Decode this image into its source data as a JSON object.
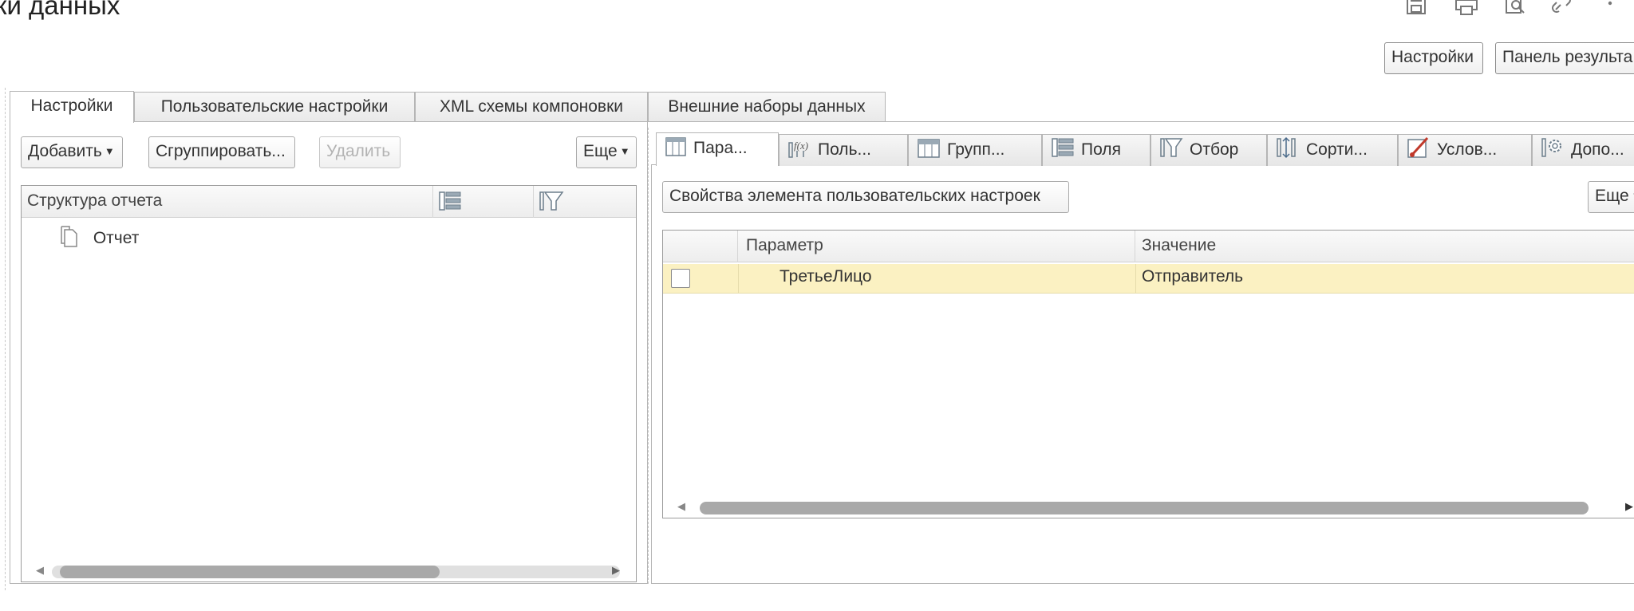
{
  "window": {
    "title": "ки данных",
    "icons": [
      "save-icon",
      "print-icon",
      "preview-icon",
      "link-icon",
      "more-vertical-icon"
    ]
  },
  "header_buttons": {
    "settings": "Настройки",
    "results_panel": "Панель результа"
  },
  "main_tabs": [
    {
      "label": "Настройки",
      "active": true
    },
    {
      "label": "Пользовательские настройки",
      "active": false
    },
    {
      "label": "XML схемы компоновки",
      "active": false
    },
    {
      "label": "Внешние наборы данных",
      "active": false
    }
  ],
  "left_panel": {
    "toolbar": {
      "add": "Добавить",
      "group": "Сгруппировать...",
      "delete": "Удалить",
      "more": "Еще"
    },
    "structure": {
      "header": "Структура отчета",
      "header_icons": [
        "fields-icon",
        "filter-icon"
      ],
      "items": [
        {
          "label": "Отчет",
          "icon": "document-icon"
        }
      ]
    }
  },
  "right_panel": {
    "tabs": [
      {
        "label": "Пара...",
        "icon": "parameters-icon",
        "active": true
      },
      {
        "label": "Поль...",
        "icon": "custom-fields-icon",
        "active": false
      },
      {
        "label": "Групп...",
        "icon": "grouping-icon",
        "active": false
      },
      {
        "label": "Поля",
        "icon": "fields-icon",
        "active": false
      },
      {
        "label": "Отбор",
        "icon": "filter-icon",
        "active": false
      },
      {
        "label": "Сорти...",
        "icon": "sort-icon",
        "active": false
      },
      {
        "label": "Услов...",
        "icon": "conditional-format-icon",
        "active": false
      },
      {
        "label": "Допо...",
        "icon": "gear-icon",
        "active": false
      }
    ],
    "toolbar": {
      "properties": "Свойства элемента пользовательских настроек",
      "more": "Еще"
    },
    "table": {
      "columns": [
        "Параметр",
        "Значение"
      ],
      "rows": [
        {
          "checked": false,
          "parameter": "ТретьеЛицо",
          "value": "Отправитель",
          "selected": true
        }
      ]
    }
  },
  "colors": {
    "selected_row": "#fbf1c2",
    "border": "#b5b5b5",
    "scroll_thumb": "#a9a9a9"
  }
}
